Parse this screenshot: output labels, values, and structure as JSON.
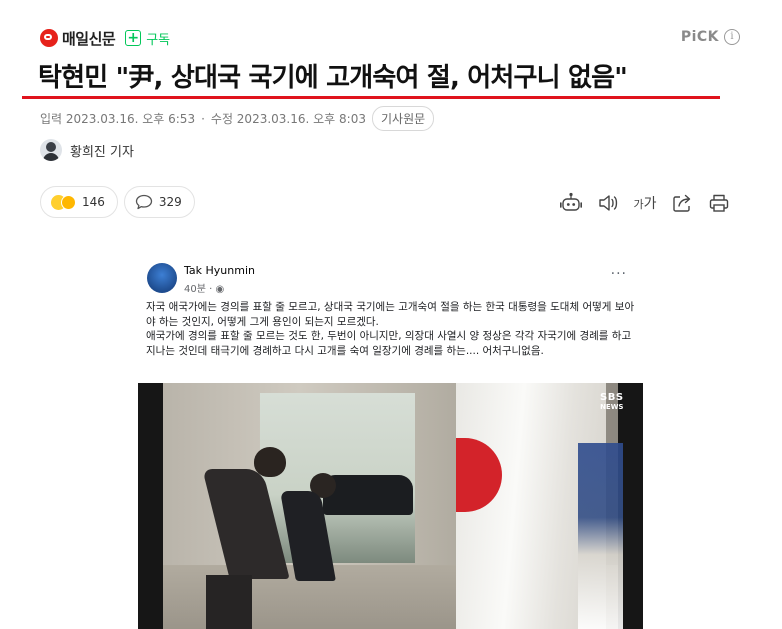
{
  "press": {
    "name": "매일신문",
    "subscribe_icon": "+",
    "subscribe_label": "구독"
  },
  "pick": {
    "label": "PiCK",
    "info_icon": "i"
  },
  "article": {
    "title": "탁현민 \"尹, 상대국 국기에 고개숙여 절, 어처구니 없음\"",
    "published": "입력 2023.03.16. 오후 6:53",
    "modified": "수정 2023.03.16. 오후 8:03",
    "original_button": "기사원문",
    "reporter": "황희진 기자"
  },
  "reactions": {
    "emotion_count": "146",
    "comment_count": "329"
  },
  "tools": {
    "font_size_small": "가",
    "font_size_large": "가"
  },
  "post": {
    "author": "Tak Hyunmin",
    "time": "40분",
    "more_icon": "···",
    "paragraphs": [
      "자국 애국가에는 경의를 표할 줄 모르고, 상대국 국기에는 고개숙여 절을 하는 한국 대통령을 도대체 어떻게 보아야 하는 것인지, 어떻게 그게 용인이 되는지 모르겠다.",
      "애국가에 경의를 표할 줄 모르는 것도 한, 두번이 아니지만, 의장대 사열시 양 정상은 각각 자국기에 경례를 하고 지나는 것인데 태극기에 경례하고 다시 고개를 숙여 일장기에 경례를 하는.... 어처구니없음."
    ],
    "photo_logo_top": "SBS",
    "photo_logo_bottom": "NEWS"
  },
  "colors": {
    "accent_red": "#e0131d",
    "subscribe_green": "#03c75a"
  }
}
